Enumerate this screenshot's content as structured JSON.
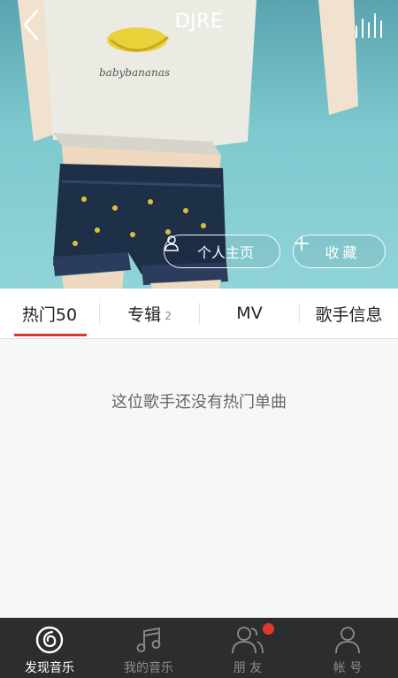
{
  "header": {
    "title": "DJRE",
    "back_icon": "chevron-left-icon",
    "player_icon": "equalizer-icon"
  },
  "actions": {
    "profile_label": "个人主页",
    "favorite_label": "收藏"
  },
  "tabs": [
    {
      "label": "热门50",
      "count": "",
      "active": true
    },
    {
      "label": "专辑",
      "count": "2",
      "active": false
    },
    {
      "label": "MV",
      "count": "",
      "active": false
    },
    {
      "label": "歌手信息",
      "count": "",
      "active": false
    }
  ],
  "empty_message": "这位歌手还没有热门单曲",
  "bottom_nav": [
    {
      "label": "发现音乐",
      "icon": "netease-music-icon",
      "active": true
    },
    {
      "label": "我的音乐",
      "icon": "music-note-icon",
      "active": false
    },
    {
      "label": "朋 友",
      "icon": "friends-icon",
      "active": false,
      "badge": true
    },
    {
      "label": "帐 号",
      "icon": "account-icon",
      "active": false
    }
  ],
  "colors": {
    "accent": "#d33a31",
    "bottom_bar": "#2c2d2f",
    "badge": "#e0392c"
  }
}
